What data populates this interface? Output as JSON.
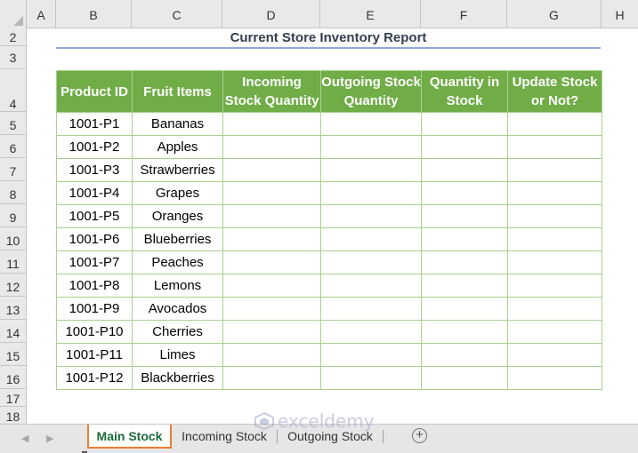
{
  "columns": [
    "A",
    "B",
    "C",
    "D",
    "E",
    "F",
    "G",
    "H"
  ],
  "rows": [
    "2",
    "3",
    "4",
    "5",
    "6",
    "7",
    "8",
    "9",
    "10",
    "11",
    "12",
    "13",
    "14",
    "15",
    "16",
    "17",
    "18"
  ],
  "report": {
    "title": "Current Store Inventory Report",
    "headers": [
      "Product ID",
      "Fruit Items",
      "Incoming Stock Quantity",
      "Outgoing Stock Quantity",
      "Quantity in Stock",
      "Update Stock or Not?"
    ],
    "items": [
      {
        "id": "1001-P1",
        "fruit": "Bananas",
        "incoming": "",
        "outgoing": "",
        "quantity": "",
        "update": ""
      },
      {
        "id": "1001-P2",
        "fruit": "Apples",
        "incoming": "",
        "outgoing": "",
        "quantity": "",
        "update": ""
      },
      {
        "id": "1001-P3",
        "fruit": "Strawberries",
        "incoming": "",
        "outgoing": "",
        "quantity": "",
        "update": ""
      },
      {
        "id": "1001-P4",
        "fruit": "Grapes",
        "incoming": "",
        "outgoing": "",
        "quantity": "",
        "update": ""
      },
      {
        "id": "1001-P5",
        "fruit": "Oranges",
        "incoming": "",
        "outgoing": "",
        "quantity": "",
        "update": ""
      },
      {
        "id": "1001-P6",
        "fruit": "Blueberries",
        "incoming": "",
        "outgoing": "",
        "quantity": "",
        "update": ""
      },
      {
        "id": "1001-P7",
        "fruit": "Peaches",
        "incoming": "",
        "outgoing": "",
        "quantity": "",
        "update": ""
      },
      {
        "id": "1001-P8",
        "fruit": "Lemons",
        "incoming": "",
        "outgoing": "",
        "quantity": "",
        "update": ""
      },
      {
        "id": "1001-P9",
        "fruit": "Avocados",
        "incoming": "",
        "outgoing": "",
        "quantity": "",
        "update": ""
      },
      {
        "id": "1001-P10",
        "fruit": "Cherries",
        "incoming": "",
        "outgoing": "",
        "quantity": "",
        "update": ""
      },
      {
        "id": "1001-P11",
        "fruit": "Limes",
        "incoming": "",
        "outgoing": "",
        "quantity": "",
        "update": ""
      },
      {
        "id": "1001-P12",
        "fruit": "Blackberries",
        "incoming": "",
        "outgoing": "",
        "quantity": "",
        "update": ""
      }
    ]
  },
  "sheet_tabs": [
    {
      "label": "Main Stock",
      "active": true
    },
    {
      "label": "Incoming Stock",
      "active": false
    },
    {
      "label": "Outgoing Stock",
      "active": false
    }
  ],
  "add_sheet_glyph": "+",
  "nav": {
    "prev": "◀",
    "next": "▶"
  },
  "watermark": {
    "text": "exceldemy",
    "icon": "exceldemy-logo-icon"
  },
  "colors": {
    "header_fill": "#70ad47",
    "cell_border": "#a9d08e",
    "title_rule": "#8ea9db",
    "active_tab_border": "#ed7d31",
    "active_tab_text": "#1e6a39"
  }
}
